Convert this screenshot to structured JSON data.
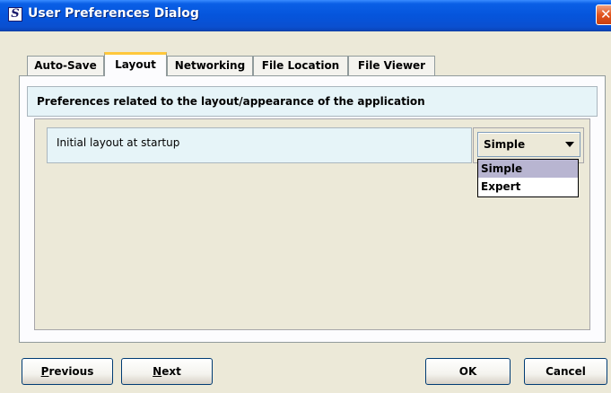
{
  "window": {
    "title": "User Preferences Dialog",
    "app_icon_letter": "S",
    "close_glyph": "✕"
  },
  "tabs": [
    {
      "label": "Auto-Save",
      "active": false
    },
    {
      "label": "Layout",
      "active": true
    },
    {
      "label": "Networking",
      "active": false
    },
    {
      "label": "File Location",
      "active": false
    },
    {
      "label": "File Viewer",
      "active": false
    }
  ],
  "section": {
    "header": "Preferences related to the layout/appearance of the application"
  },
  "preference": {
    "label": "Initial layout at startup",
    "selected": "Simple",
    "options": [
      "Simple",
      "Expert"
    ]
  },
  "buttons": {
    "previous": {
      "mnemonic": "P",
      "rest": "revious"
    },
    "next": {
      "mnemonic": "N",
      "rest": "ext"
    },
    "ok": "OK",
    "cancel": "Cancel"
  },
  "colors": {
    "titlebar": "#0555DC",
    "active_tab_accent": "#FFC83C",
    "header_bg": "#E6F4F8",
    "dropdown_highlight": "#B8B5D1"
  }
}
